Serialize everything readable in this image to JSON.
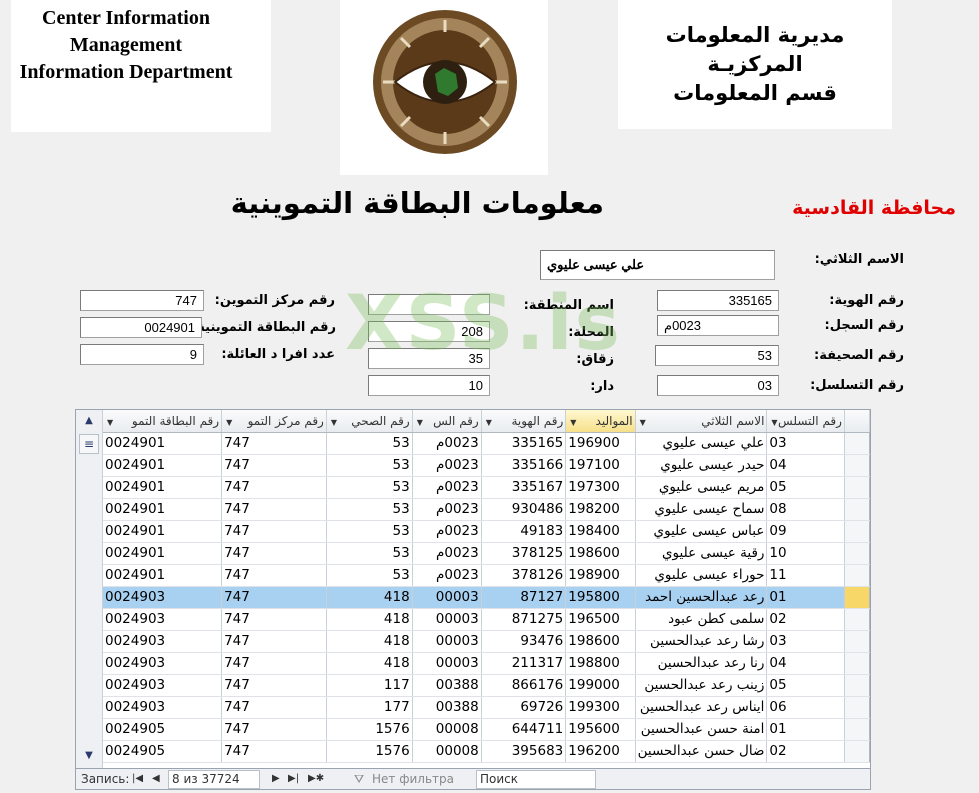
{
  "header": {
    "english_lines": [
      "Center Information",
      "Management",
      "Information Department"
    ],
    "arabic_lines": [
      "مديرية المعلومات المركزيـة",
      "قسم المعلومات"
    ],
    "main_title": "معلومات البطاقة التموينية",
    "governorate": "محافظة القادسية"
  },
  "watermark": "XSS.is",
  "form": {
    "full_name": {
      "label": "الاسم الثلاثي:",
      "value": "علي عيسى عليوي"
    },
    "id_number": {
      "label": "رقم الهوية:",
      "value": "335165"
    },
    "register_number": {
      "label": "رقم السجل:",
      "value": "0023م"
    },
    "page_number": {
      "label": "رقم الصحيفة:",
      "value": "53"
    },
    "serial_number": {
      "label": "رقم التسلسل:",
      "value": "03"
    },
    "area_name": {
      "label": "اسم المنطقة:",
      "value": ""
    },
    "locality": {
      "label": "المحلة:",
      "value": "208"
    },
    "alley": {
      "label": "زقاق:",
      "value": "35"
    },
    "house": {
      "label": "دار:",
      "value": "10"
    },
    "ration_center": {
      "label": "رقم مركز التموين:",
      "value": "747"
    },
    "ration_card": {
      "label": "رقم البطاقة التموينية:",
      "value": "0024901"
    },
    "family_count": {
      "label": "عدد افرا د العائلة:",
      "value": "9"
    }
  },
  "grid": {
    "columns": [
      "رقم البطاقة التمو",
      "رقم مركز التمو",
      "رقم الصحي",
      "رقم الس",
      "رقم الهوية",
      "المواليد",
      "الاسم الثلاثي",
      "رقم التسلس"
    ],
    "rows": [
      {
        "card": "0024901",
        "center": "747",
        "page": "53",
        "reg": "0023م",
        "id": "335165",
        "birth": "196900",
        "name": "علي عيسى عليوي",
        "serial": "03"
      },
      {
        "card": "0024901",
        "center": "747",
        "page": "53",
        "reg": "0023م",
        "id": "335166",
        "birth": "197100",
        "name": "حيدر عيسى عليوي",
        "serial": "04"
      },
      {
        "card": "0024901",
        "center": "747",
        "page": "53",
        "reg": "0023م",
        "id": "335167",
        "birth": "197300",
        "name": "مريم عيسى عليوي",
        "serial": "05"
      },
      {
        "card": "0024901",
        "center": "747",
        "page": "53",
        "reg": "0023م",
        "id": "930486",
        "birth": "198200",
        "name": "سماح عيسى عليوي",
        "serial": "08"
      },
      {
        "card": "0024901",
        "center": "747",
        "page": "53",
        "reg": "0023م",
        "id": "49183",
        "birth": "198400",
        "name": "عباس عيسى عليوي",
        "serial": "09"
      },
      {
        "card": "0024901",
        "center": "747",
        "page": "53",
        "reg": "0023م",
        "id": "378125",
        "birth": "198600",
        "name": "رقية عيسى عليوي",
        "serial": "10"
      },
      {
        "card": "0024901",
        "center": "747",
        "page": "53",
        "reg": "0023م",
        "id": "378126",
        "birth": "198900",
        "name": "حوراء عيسى عليوي",
        "serial": "11"
      },
      {
        "card": "0024903",
        "center": "747",
        "page": "418",
        "reg": "00003",
        "id": "87127",
        "birth": "195800",
        "name": "رعد عبدالحسين احمد",
        "serial": "01"
      },
      {
        "card": "0024903",
        "center": "747",
        "page": "418",
        "reg": "00003",
        "id": "871275",
        "birth": "196500",
        "name": "سلمى كطن عبود",
        "serial": "02"
      },
      {
        "card": "0024903",
        "center": "747",
        "page": "418",
        "reg": "00003",
        "id": "93476",
        "birth": "198600",
        "name": "رشا رعد عبدالحسين",
        "serial": "03"
      },
      {
        "card": "0024903",
        "center": "747",
        "page": "418",
        "reg": "00003",
        "id": "211317",
        "birth": "198800",
        "name": "رنا رعد عبدالحسين",
        "serial": "04"
      },
      {
        "card": "0024903",
        "center": "747",
        "page": "117",
        "reg": "00388",
        "id": "866176",
        "birth": "199000",
        "name": "زينب رعد عبدالحسين",
        "serial": "05"
      },
      {
        "card": "0024903",
        "center": "747",
        "page": "177",
        "reg": "00388",
        "id": "69726",
        "birth": "199300",
        "name": "ايناس رعد عبدالحسين",
        "serial": "06"
      },
      {
        "card": "0024905",
        "center": "747",
        "page": "1576",
        "reg": "00008",
        "id": "644711",
        "birth": "195600",
        "name": "امنة حسن عبدالحسين",
        "serial": "01"
      },
      {
        "card": "0024905",
        "center": "747",
        "page": "1576",
        "reg": "00008",
        "id": "395683",
        "birth": "196200",
        "name": "ضال حسن عبدالحسين",
        "serial": "02"
      }
    ],
    "selected_row": 7
  },
  "navigation": {
    "record_label": "Запись:",
    "record_position": "8 из 37724",
    "filter_label": "Нет фильтра",
    "search_label": "Поиск"
  },
  "colors": {
    "governorate": "#e00000",
    "selected_row": "#a8d0f0",
    "selector_current": "#f7d768",
    "watermark": "#78be5a"
  }
}
